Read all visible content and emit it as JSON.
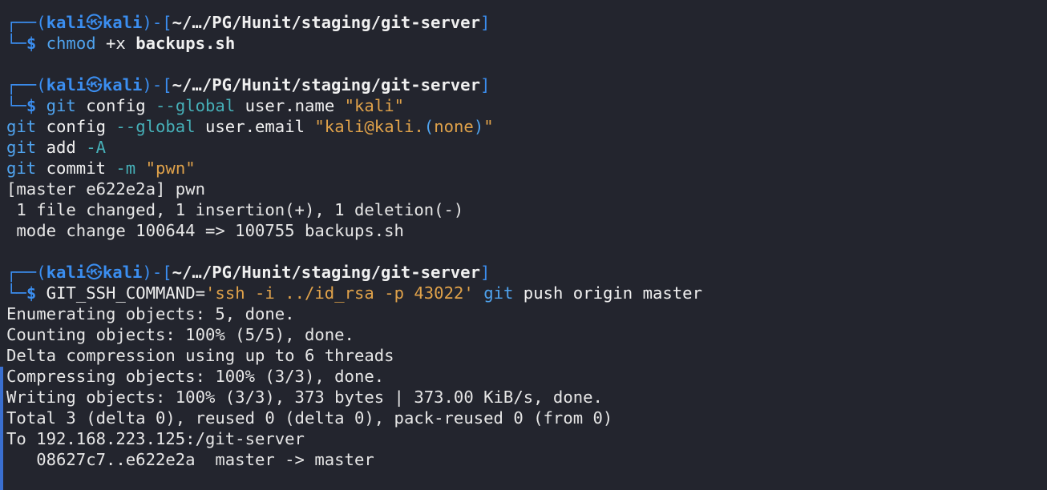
{
  "theme": {
    "background": "#23252e",
    "prompt_color": "#3b8ef0",
    "command_color": "#4fa3ee",
    "option_color": "#46b0b8",
    "string_color": "#e0a24a",
    "output_color": "#e6e6e6"
  },
  "prompt": {
    "corner_top": "┌──(",
    "user": "kali",
    "at": "㉿",
    "host": "kali",
    "sep": ")-[",
    "path": "~/…/PG/Hunit/staging/git-server",
    "close": "]",
    "corner_bottom": "└─",
    "dollar": "$"
  },
  "blocks": [
    {
      "command": [
        {
          "t": "chmod",
          "c": "cmd"
        },
        {
          "t": " +x ",
          "c": "plain"
        },
        {
          "t": "backups.sh",
          "c": "bold"
        }
      ]
    },
    {
      "command": [
        {
          "t": "git",
          "c": "cmd"
        },
        {
          "t": " config ",
          "c": "plain"
        },
        {
          "t": "--global",
          "c": "opt"
        },
        {
          "t": " user.name ",
          "c": "plain"
        },
        {
          "t": "\"kali\"",
          "c": "str"
        }
      ],
      "continuation": [
        [
          {
            "t": "git",
            "c": "cmd"
          },
          {
            "t": " config ",
            "c": "plain"
          },
          {
            "t": "--global",
            "c": "opt"
          },
          {
            "t": " user.email ",
            "c": "plain"
          },
          {
            "t": "\"kali@kali.",
            "c": "str"
          },
          {
            "t": "(",
            "c": "cmd"
          },
          {
            "t": "none",
            "c": "str"
          },
          {
            "t": ")",
            "c": "cmd"
          },
          {
            "t": "\"",
            "c": "str"
          }
        ],
        [
          {
            "t": "git",
            "c": "cmd"
          },
          {
            "t": " add ",
            "c": "plain"
          },
          {
            "t": "-A",
            "c": "opt"
          }
        ],
        [
          {
            "t": "git",
            "c": "cmd"
          },
          {
            "t": " commit ",
            "c": "plain"
          },
          {
            "t": "-m",
            "c": "opt"
          },
          {
            "t": " ",
            "c": "plain"
          },
          {
            "t": "\"pwn\"",
            "c": "str"
          }
        ]
      ],
      "output": [
        "[master e622e2a] pwn",
        " 1 file changed, 1 insertion(+), 1 deletion(-)",
        " mode change 100644 => 100755 backups.sh"
      ]
    },
    {
      "command": [
        {
          "t": "GIT_SSH_COMMAND=",
          "c": "plain"
        },
        {
          "t": "'ssh -i ../id_rsa -p 43022'",
          "c": "str"
        },
        {
          "t": " ",
          "c": "plain"
        },
        {
          "t": "git",
          "c": "cmd"
        },
        {
          "t": " push origin master",
          "c": "plain"
        }
      ],
      "output": [
        "Enumerating objects: 5, done.",
        "Counting objects: 100% (5/5), done.",
        "Delta compression using up to 6 threads",
        "Compressing objects: 100% (3/3), done.",
        "Writing objects: 100% (3/3), 373 bytes | 373.00 KiB/s, done.",
        "Total 3 (delta 0), reused 0 (delta 0), pack-reused 0 (from 0)",
        "To 192.168.223.125:/git-server",
        "   08627c7..e622e2a  master -> master"
      ]
    }
  ]
}
